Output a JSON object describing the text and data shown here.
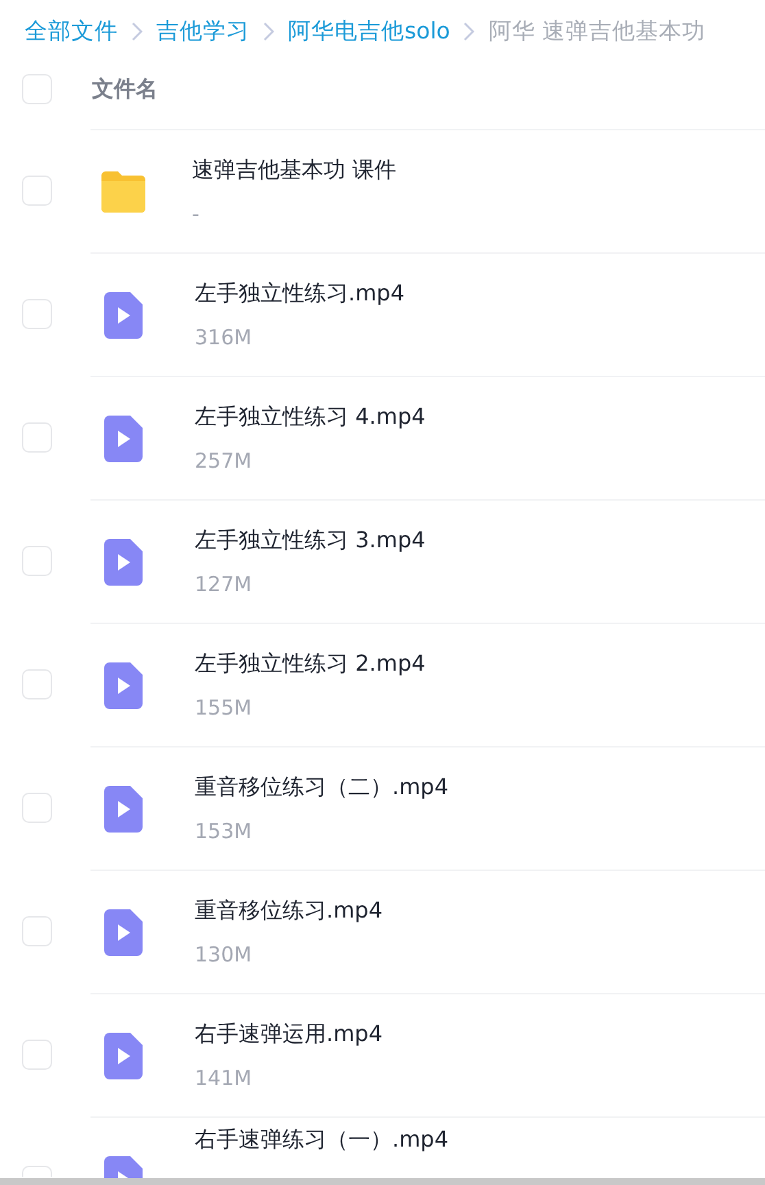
{
  "breadcrumb": [
    {
      "label": "全部文件",
      "current": false
    },
    {
      "label": "吉他学习",
      "current": false
    },
    {
      "label": "阿华电吉他solo",
      "current": false
    },
    {
      "label": "阿华 速弹吉他基本功",
      "current": true
    }
  ],
  "header": {
    "checked": false,
    "label": "文件名"
  },
  "files": [
    {
      "kind": "folder",
      "name": "速弹吉他基本功 课件",
      "size": "-",
      "checked": false
    },
    {
      "kind": "video",
      "name": "左手独立性练习.mp4",
      "size": "316M",
      "checked": false
    },
    {
      "kind": "video",
      "name": "左手独立性练习 4.mp4",
      "size": "257M",
      "checked": false
    },
    {
      "kind": "video",
      "name": "左手独立性练习 3.mp4",
      "size": "127M",
      "checked": false
    },
    {
      "kind": "video",
      "name": "左手独立性练习 2.mp4",
      "size": "155M",
      "checked": false
    },
    {
      "kind": "video",
      "name": "重音移位练习（二）.mp4",
      "size": "153M",
      "checked": false
    },
    {
      "kind": "video",
      "name": "重音移位练习.mp4",
      "size": "130M",
      "checked": false
    },
    {
      "kind": "video",
      "name": "右手速弹运用.mp4",
      "size": "141M",
      "checked": false
    },
    {
      "kind": "video",
      "name": "右手速弹练习（一）.mp4",
      "checked": false
    }
  ]
}
